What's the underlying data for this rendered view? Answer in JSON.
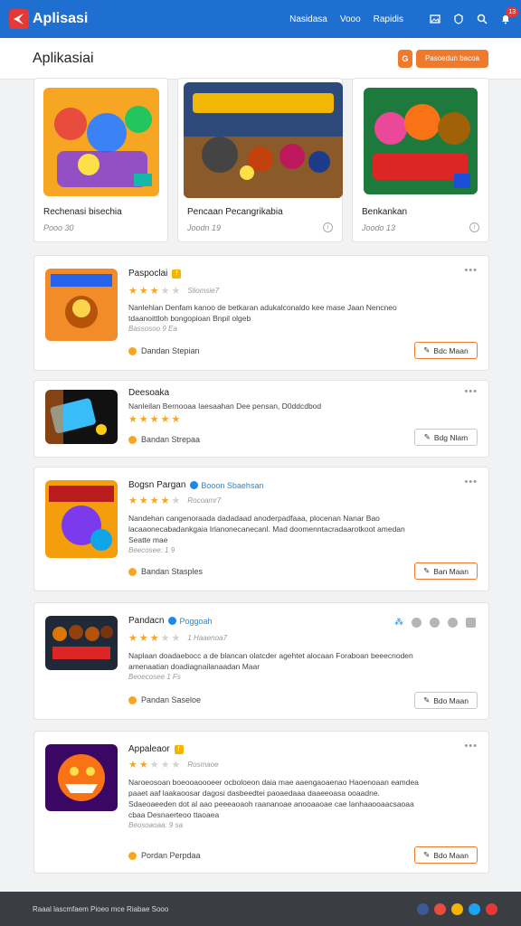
{
  "app": {
    "name": "Aplisasi",
    "nav": [
      "Nasidasa",
      "Vooo",
      "Rapidis"
    ],
    "notification_count": "13"
  },
  "subheader": {
    "title": "Aplikasiai",
    "button_icon": "G",
    "button_label": "Pasoedun bacoa"
  },
  "featured": [
    {
      "title": "Rechenasi bisechia",
      "meta": "Pooo 30"
    },
    {
      "title": "Pencaan Pecangrikabia",
      "meta": "Joodn 19"
    },
    {
      "title": "Benkankan",
      "meta": "Joodo 13"
    }
  ],
  "items": [
    {
      "name": "Paspoclai",
      "rating_text": "Sliomsie7",
      "rating": 3,
      "desc": "Nanlehlan Denfam kanoo de betkaran adukalconaldo kee mase Jaan Nencneo tdaanoittloh bongopioan Bnpil olgeb",
      "subdesc": "Bassosoo 9 Ea",
      "category": "Dandan Stepian",
      "action_label": "Bdc Maan",
      "action_style": "orange"
    },
    {
      "name": "Deesoaka",
      "rating_text": "",
      "rating": 5,
      "desc": "Nanleilan Bernooaa Iaesaahan Dee pensan, D0ddcdbod",
      "subdesc": "",
      "category": "Bandan Strepaa",
      "action_label": "Bdg Nlam",
      "action_style": "grey"
    },
    {
      "name": "Bogsn Pargan",
      "verified_label": "Booon Sbaehsan",
      "rating_text": "Rocoamr7",
      "rating": 4,
      "desc": "Nandehan cangenoraada dadadaad anoderpadfaaa, plocenan Nanar Bao lacaaonecabadankgaia Irlanonecanecanl. Mad doomenntacradaarotkoot amedan Seatte mae",
      "subdesc": "Beecosee: 1 9",
      "category": "Bandan Stasples",
      "action_label": "Ban Maan",
      "action_style": "orange"
    },
    {
      "name": "Pandacn",
      "verified_label": "Poggoah",
      "rating_text": "1 Haaenoa7",
      "rating": 3,
      "desc": "Naplaan doadaebocc a de blancan olatcder agehtet alocaan Foraboan beeecnoden amenaatian doadiagnailanaadan Maar",
      "subdesc": "Beoecosee 1 Fs",
      "category": "Pandan Saseloe",
      "action_label": "Bdo Maan",
      "action_style": "grey"
    },
    {
      "name": "Appaleaor",
      "rating_text": "Rosmaoe",
      "rating": 2,
      "desc": "Naroeosoan boeooaoooeer ocboloeon daia mae aaengaoaenao Haoenoaan eamdea paaet aaf laakaoosar dagosi dasbeedtei paoaedaaa daaeeoasa ooaadne. Sdaeoaeeden dot al aao peeeaoaoh raananoae anooaaoae cae lanhaaooaacsaoaa cbaa Desnaerteoo ttaoaea",
      "subdesc": "Beosoaoaa: 9 sa",
      "category": "Pordan Perpdaa",
      "action_label": "Bdo Maan",
      "action_style": "orange"
    }
  ],
  "footer": {
    "text": "Raaal lascmfaem Pioeo mce Riabae Sooo"
  }
}
